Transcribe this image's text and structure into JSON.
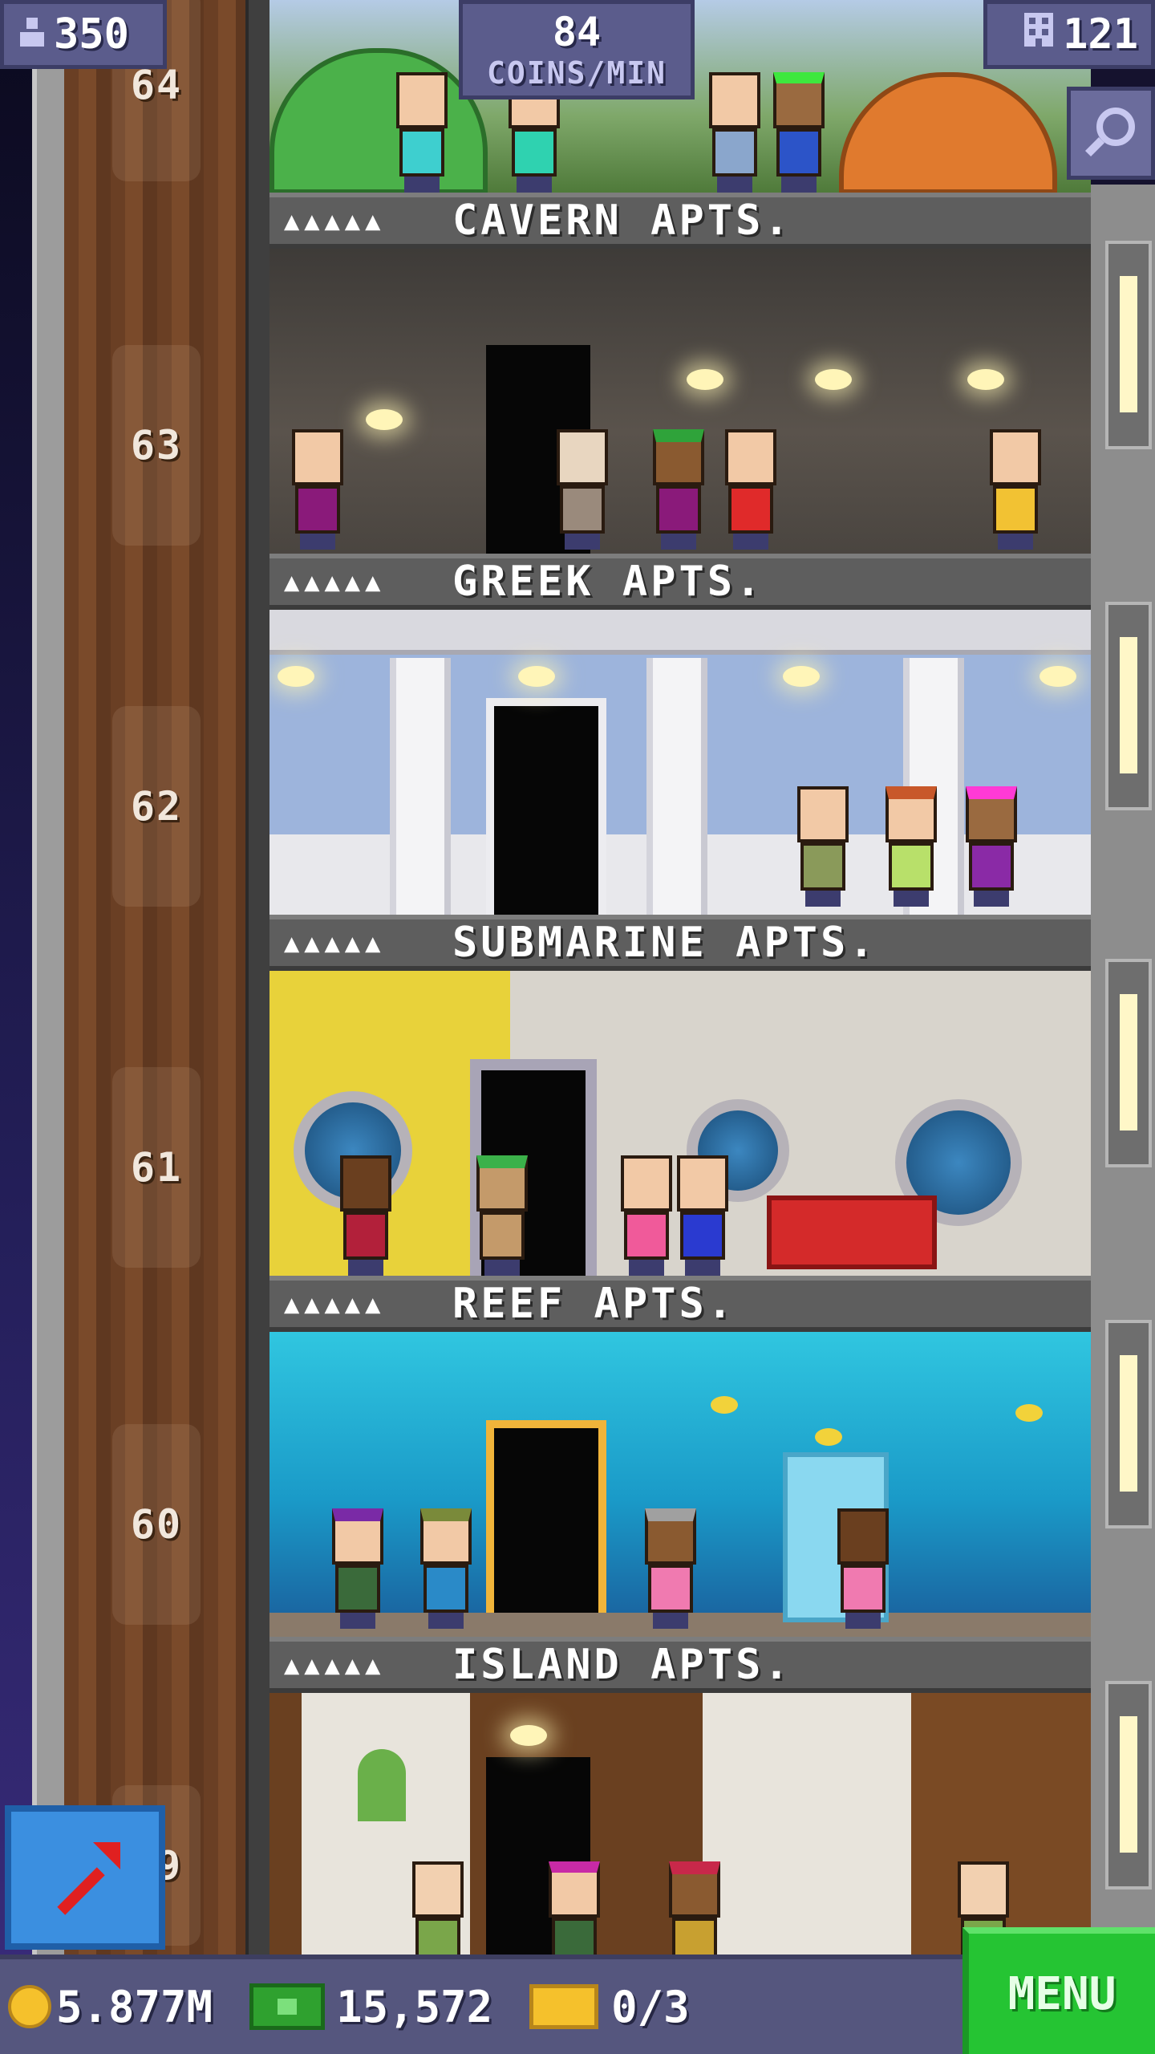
{
  "hud": {
    "population": "350",
    "coins_per_min_value": "84",
    "coins_per_min_unit": "COINS/MIN",
    "floor_count": "121"
  },
  "floor_numbers": [
    "64",
    "63",
    "62",
    "61",
    "60",
    "59"
  ],
  "floors": [
    {
      "label": "CAVERN APTS.",
      "stars": "▲▲▲▲▲"
    },
    {
      "label": "GREEK APTS.",
      "stars": "▲▲▲▲▲"
    },
    {
      "label": "SUBMARINE APTS.",
      "stars": "▲▲▲▲▲"
    },
    {
      "label": "REEF APTS.",
      "stars": "▲▲▲▲▲"
    },
    {
      "label": "ISLAND APTS.",
      "stars": "▲▲▲▲▲"
    }
  ],
  "bottom_bar": {
    "coins": "5.877M",
    "bux": "15,572",
    "tickets": "0/3",
    "menu_label": "MENU"
  },
  "icons": {
    "population": "person-icon",
    "floors": "building-icon",
    "search": "magnifier-icon",
    "build": "arrow-up-right-icon",
    "coin": "coin-icon",
    "bux": "bux-icon",
    "ticket": "ticket-icon"
  },
  "colors": {
    "menu": "#25c433",
    "hud": "#5b5c8c",
    "coin": "#f5c12c",
    "bux": "#2fa12f"
  }
}
